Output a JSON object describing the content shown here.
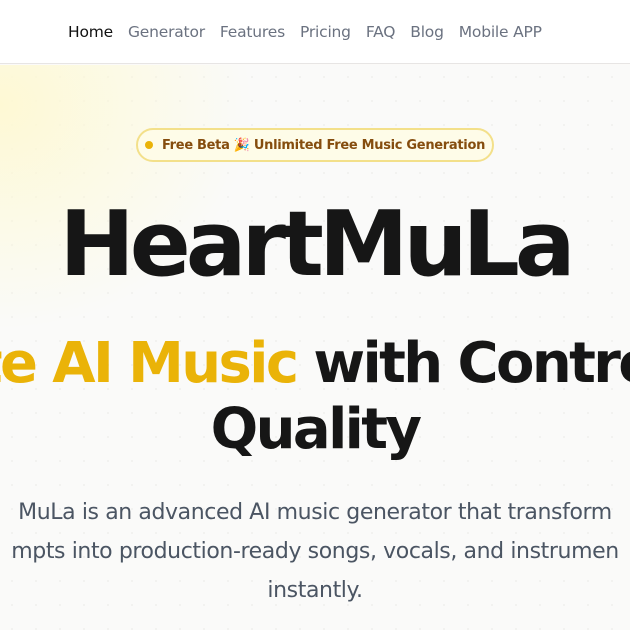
{
  "nav": {
    "items": [
      {
        "label": "Home"
      },
      {
        "label": "Generator"
      },
      {
        "label": "Features"
      },
      {
        "label": "Pricing"
      },
      {
        "label": "FAQ"
      },
      {
        "label": "Blog"
      },
      {
        "label": "Mobile APP"
      }
    ]
  },
  "hero": {
    "badge": "Free Beta 🎉 Unlimited Free Music Generation",
    "title": "HeartMuLa",
    "headline_accent": "te AI Music",
    "headline_rest_line1": " with Contro",
    "headline_line2": "Quality",
    "description_line1": "MuLa is an advanced AI music generator that transform",
    "description_line2": "mpts into production-ready songs, vocals, and instrumen",
    "description_line3": "instantly."
  },
  "colors": {
    "accent": "#eab308",
    "text": "#161616",
    "muted": "#6b7280"
  }
}
